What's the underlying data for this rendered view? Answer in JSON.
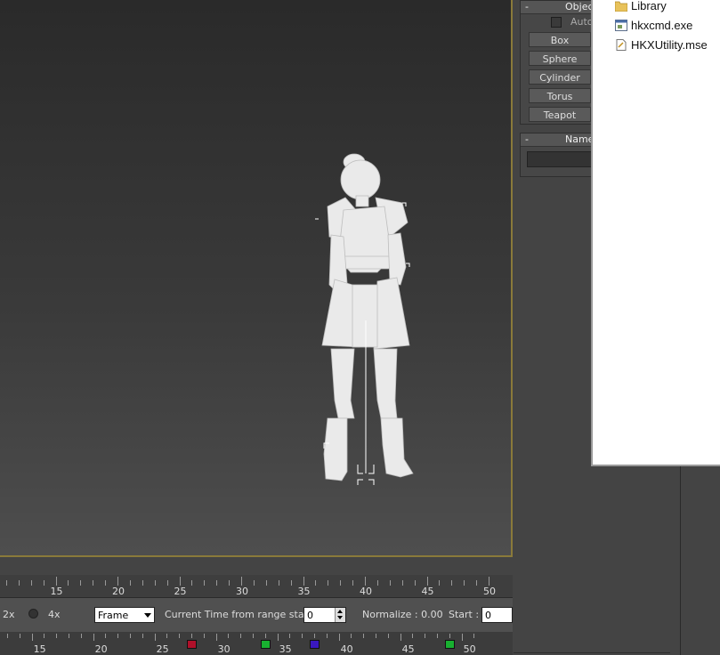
{
  "command_panel": {
    "object_type_rollout": {
      "title": "Object Type",
      "title_visible": "Objec",
      "toggle": "-",
      "autogrid_label": "Auto",
      "buttons": [
        "Box",
        "Sphere",
        "Cylinder",
        "Torus",
        "Teapot"
      ]
    },
    "name_color_rollout": {
      "title_visible": "Name a",
      "toggle": "-"
    }
  },
  "explorer": {
    "items": [
      {
        "name": "Library",
        "icon": "folder-icon"
      },
      {
        "name": "hkxcmd.exe",
        "icon": "exe-icon"
      },
      {
        "name": "HKXUtility.mse",
        "icon": "script-file-icon"
      }
    ]
  },
  "time_ruler": {
    "labels": [
      "15",
      "20",
      "25",
      "30",
      "35",
      "40",
      "45",
      "50"
    ]
  },
  "time_controls": {
    "speed_2x": "2x",
    "speed_4x": "4x",
    "time_display": "Frame",
    "current_time_label": "Current Time from range start :",
    "current_time_value": "0",
    "normalize_label": "Normalize : 0.00",
    "start_label": "Start :",
    "start_value": "0"
  },
  "track_bar": {
    "labels": [
      "15",
      "20",
      "25",
      "30",
      "35",
      "40",
      "45",
      "50"
    ],
    "keys": [
      {
        "frame": 28,
        "color": "#b0102a"
      },
      {
        "frame": 34,
        "color": "#18b030"
      },
      {
        "frame": 38,
        "color": "#3a18c0"
      },
      {
        "frame": 49,
        "color": "#18b030"
      }
    ]
  },
  "colors": {
    "viewport_border": "#8a7a3a",
    "ui_background": "#444444"
  }
}
